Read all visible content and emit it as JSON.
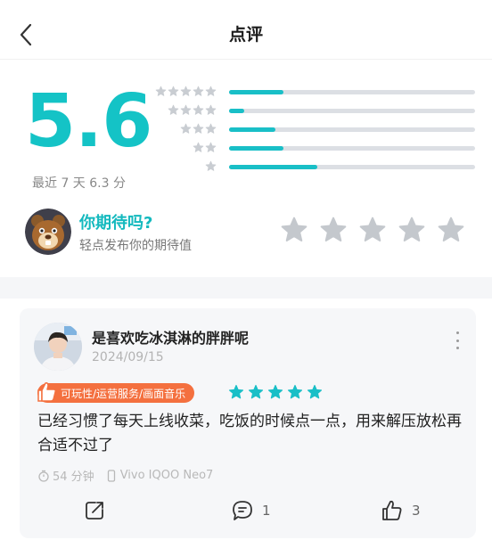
{
  "header": {
    "title": "点评"
  },
  "rating": {
    "score": "5.6",
    "recent_label": "最近 7 天 6.3 分",
    "distribution": [
      {
        "stars": 5,
        "fraction": 0.22
      },
      {
        "stars": 4,
        "fraction": 0.06
      },
      {
        "stars": 3,
        "fraction": 0.19
      },
      {
        "stars": 2,
        "fraction": 0.22
      },
      {
        "stars": 1,
        "fraction": 0.36
      }
    ],
    "colors": {
      "accent": "#14c3c6",
      "bar_fill": "#19bfc7",
      "bar_track": "#dcdfe4",
      "star_gray": "#c9cdd2"
    }
  },
  "expect": {
    "title": "你期待吗?",
    "subtitle": "轻点发布你的期待值",
    "star_count": 5
  },
  "review": {
    "user_name": "是喜欢吃冰淇淋的胖胖呢",
    "date": "2024/09/15",
    "tag": "可玩性/运营服务/画面音乐",
    "stars": 5,
    "text": "已经习惯了每天上线收菜，吃饭的时候点一点，用来解压放松再合适不过了",
    "play_time": "54 分钟",
    "device": "Vivo IQOO Neo7",
    "comment_count": "1",
    "like_count": "3",
    "colors": {
      "tag_bg": "#f4703f",
      "star": "#19bfc7"
    }
  }
}
